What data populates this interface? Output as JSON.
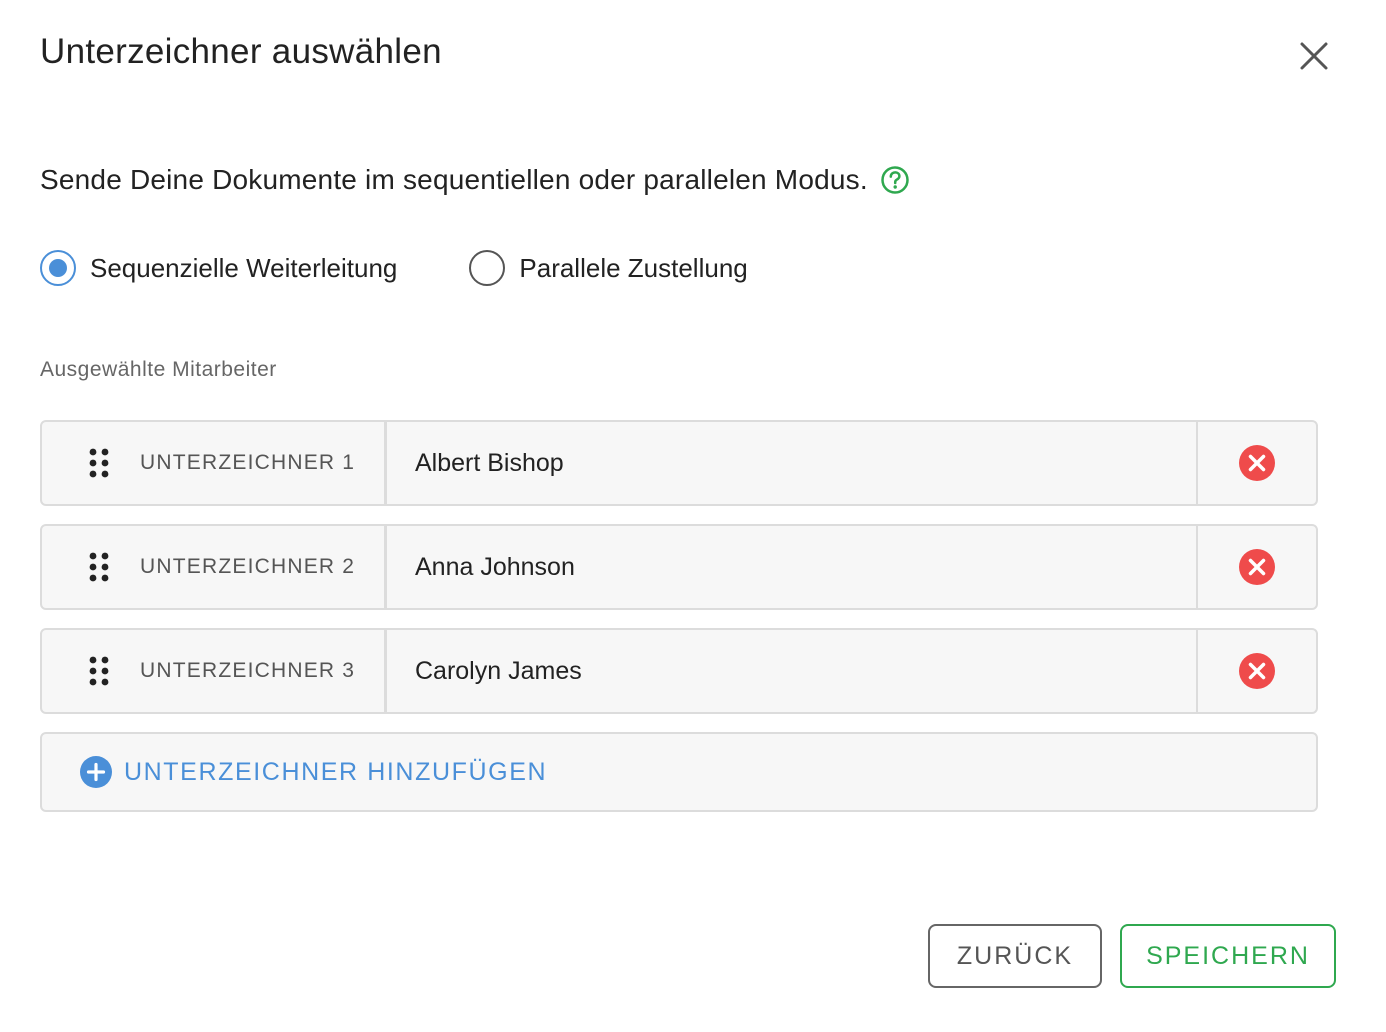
{
  "dialog": {
    "title": "Unterzeichner auswählen",
    "description": "Sende Deine Dokumente im sequentiellen oder parallelen Modus.",
    "close_icon": "close-icon",
    "help_icon": "question-circle-icon"
  },
  "mode": {
    "options": [
      {
        "label": "Sequenzielle Weiterleitung",
        "selected": true
      },
      {
        "label": "Parallele Zustellung",
        "selected": false
      }
    ]
  },
  "section_label": "Ausgewählte Mitarbeiter",
  "signers": [
    {
      "label": "UNTERZEICHNER 1",
      "name": "Albert Bishop"
    },
    {
      "label": "UNTERZEICHNER 2",
      "name": "Anna Johnson"
    },
    {
      "label": "UNTERZEICHNER 3",
      "name": "Carolyn James"
    }
  ],
  "add_signer_label": "UNTERZEICHNER HINZUFÜGEN",
  "buttons": {
    "back": "ZURÜCK",
    "save": "SPEICHERN"
  },
  "colors": {
    "accent_blue": "#4a8fd8",
    "success_green": "#2fa84f",
    "remove_red": "#ef4b4b"
  }
}
